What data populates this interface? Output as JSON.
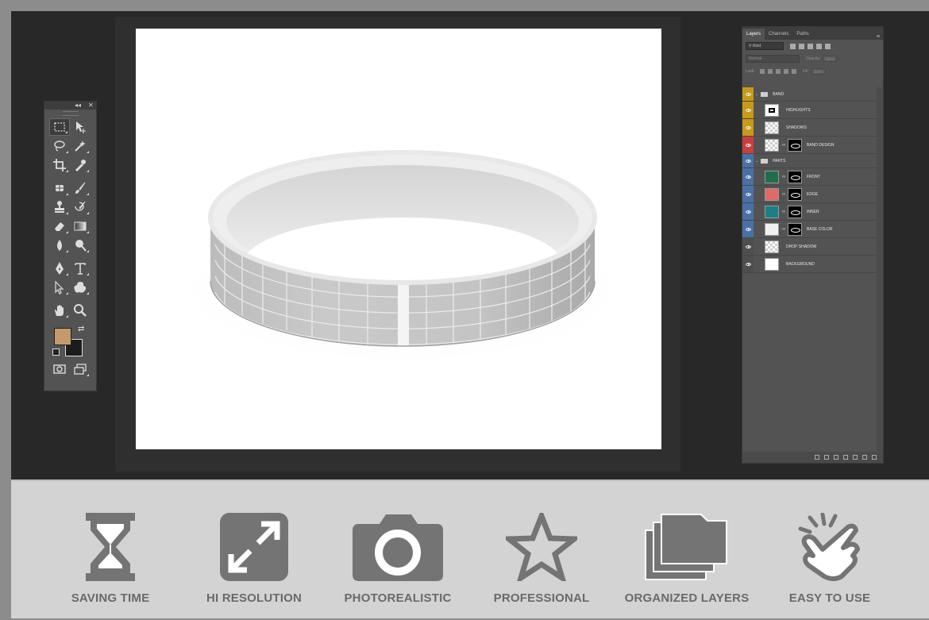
{
  "layers_panel": {
    "tabs": [
      "Layers",
      "Channels",
      "Paths"
    ],
    "active_tab": "Layers",
    "filter_kind": "Kind",
    "blend_mode": "Normal",
    "opacity_label": "Opacity:",
    "opacity_value": "100%",
    "lock_label": "Lock:",
    "fill_label": "Fill:",
    "fill_value": "100%",
    "layers": [
      {
        "name": "BAND",
        "type": "group",
        "tag_color": "#c79a1a",
        "thumb": "",
        "mask": false
      },
      {
        "name": "HIGHLIGHTS",
        "type": "layer",
        "tag_color": "#c79a1a",
        "thumb": "ring",
        "mask": false
      },
      {
        "name": "SHADOWS",
        "type": "layer",
        "tag_color": "#c79a1a",
        "thumb": "checker",
        "mask": false
      },
      {
        "name": "BAND DESIGN",
        "type": "smart",
        "tag_color": "#c7403f",
        "thumb": "checker",
        "mask": true
      },
      {
        "name": "PARTS",
        "type": "group",
        "tag_color": "#4a71a6",
        "thumb": "",
        "mask": false
      },
      {
        "name": "FRONT",
        "type": "layer",
        "tag_color": "#4a71a6",
        "thumb": "#1f6e4d",
        "mask": true
      },
      {
        "name": "EDGE",
        "type": "layer",
        "tag_color": "#4a71a6",
        "thumb": "#e06a6a",
        "mask": true
      },
      {
        "name": "INNER",
        "type": "layer",
        "tag_color": "#4a71a6",
        "thumb": "#1b7f85",
        "mask": true
      },
      {
        "name": "BASE COLOR",
        "type": "layer",
        "tag_color": "#4a71a6",
        "thumb": "#f0f0f0",
        "mask": true
      },
      {
        "name": "DROP SHADOW",
        "type": "layer",
        "tag_color": "",
        "thumb": "checker",
        "mask": false
      },
      {
        "name": "BACKGROUND",
        "type": "layer",
        "tag_color": "",
        "thumb": "#ffffff",
        "mask": false
      }
    ]
  },
  "tools_panel": {
    "foreground_color": "#c49a6c",
    "background_color": "#1c1c1c",
    "tools": [
      [
        "marquee-icon",
        "move-icon"
      ],
      [
        "lasso-icon",
        "magic-wand-icon"
      ],
      [
        "crop-icon",
        "eyedropper-icon"
      ],
      [
        "healing-brush-icon",
        "brush-icon"
      ],
      [
        "clone-stamp-icon",
        "history-brush-icon"
      ],
      [
        "eraser-icon",
        "gradient-icon"
      ],
      [
        "blur-icon",
        "dodge-icon"
      ],
      [
        "pen-icon",
        "type-icon"
      ],
      [
        "path-selection-icon",
        "custom-shape-icon"
      ],
      [
        "hand-icon",
        "zoom-icon"
      ]
    ]
  },
  "features": [
    {
      "label": "SAVING TIME",
      "icon": "hourglass-icon"
    },
    {
      "label": "HI RESOLUTION",
      "icon": "expand-arrows-icon"
    },
    {
      "label": "PHOTOREALISTIC",
      "icon": "camera-icon"
    },
    {
      "label": "PROFESSIONAL",
      "icon": "star-icon"
    },
    {
      "label": "ORGANIZED LAYERS",
      "icon": "folders-icon"
    },
    {
      "label": "EASY TO USE",
      "icon": "tap-hand-icon"
    }
  ],
  "colors": {
    "workspace": "#282828",
    "panel": "#535353",
    "feature_strip": "#d3d3d3",
    "feature_icon": "#747474",
    "feature_text": "#6a6a6a"
  }
}
